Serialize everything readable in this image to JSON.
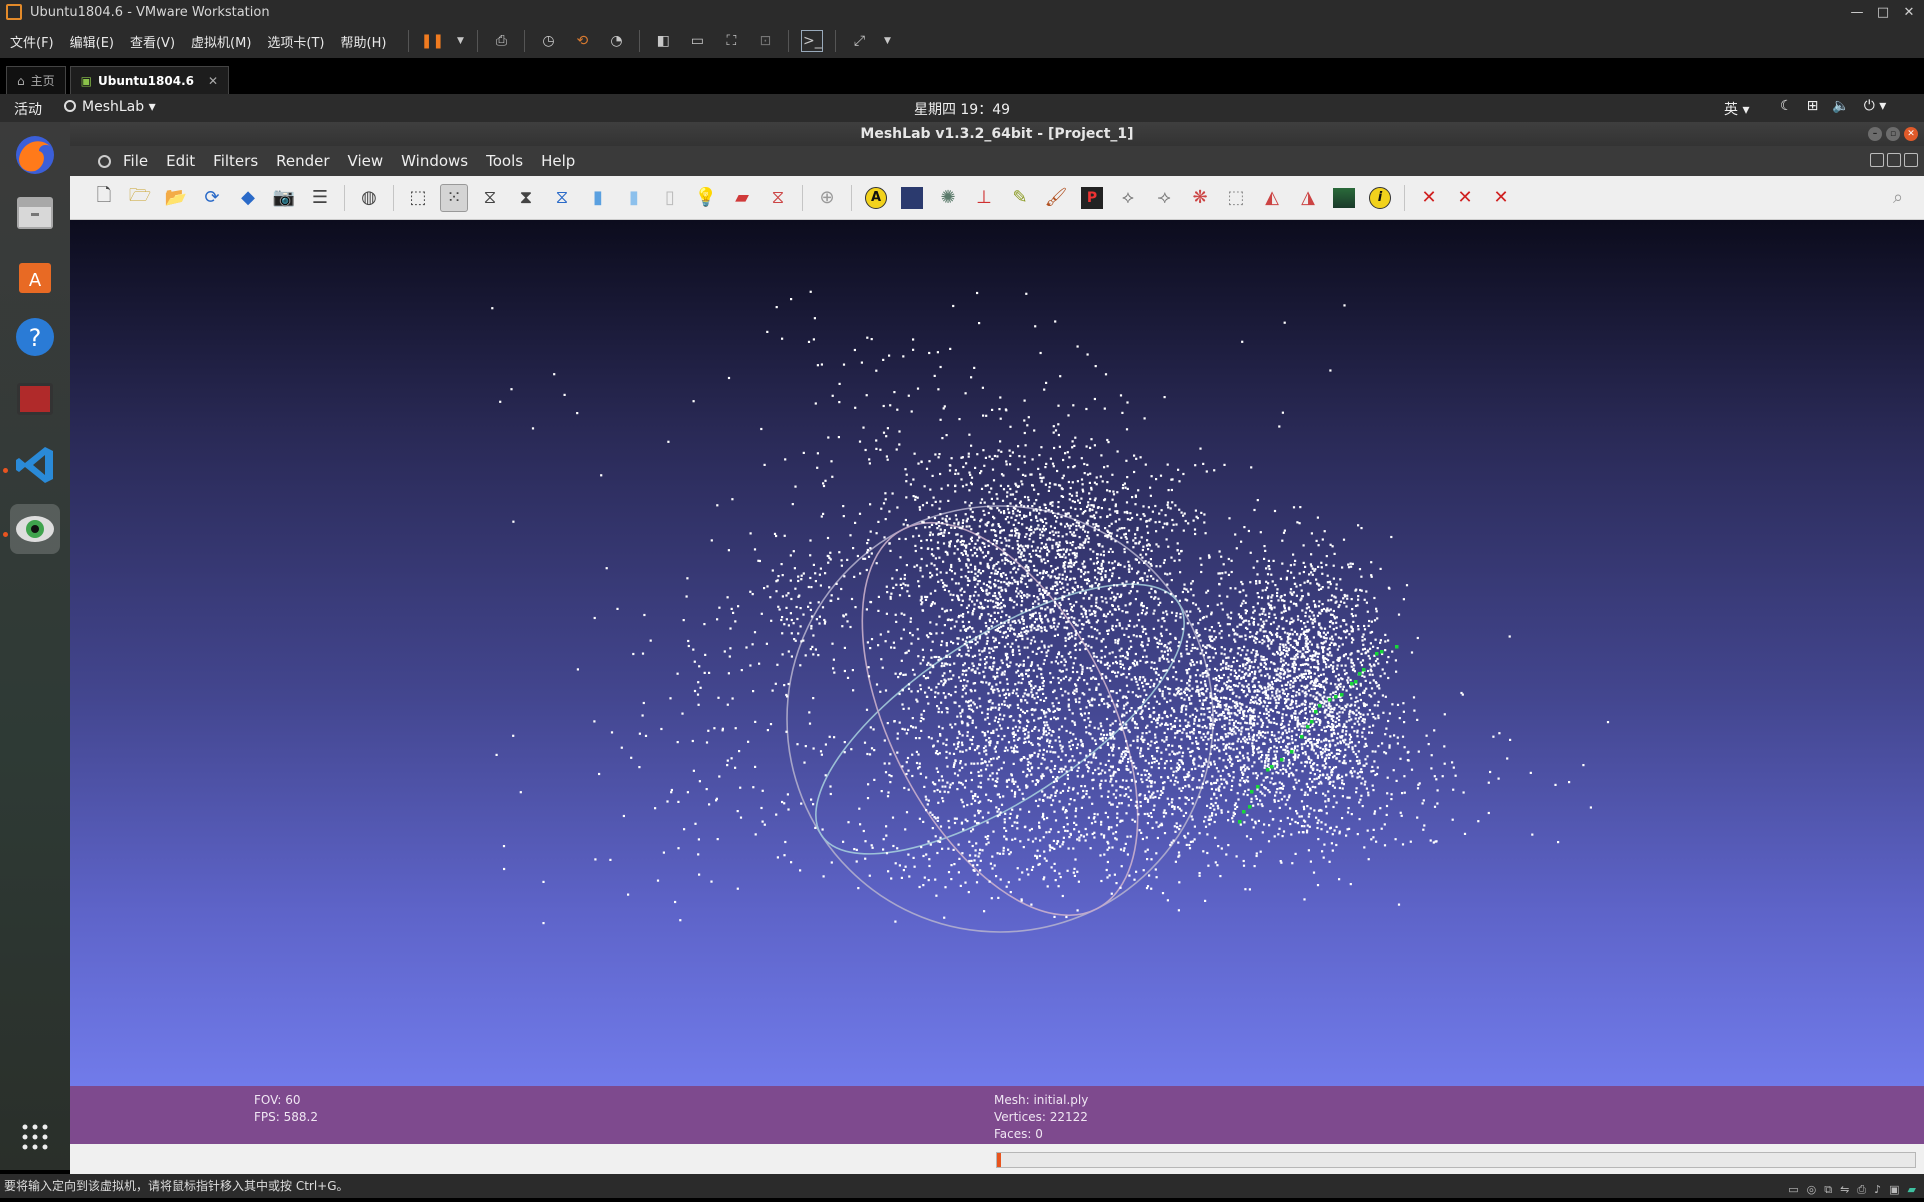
{
  "vmware": {
    "title": "Ubuntu1804.6 - VMware Workstation",
    "menus": [
      "文件(F)",
      "编辑(E)",
      "查看(V)",
      "虚拟机(M)",
      "选项卡(T)",
      "帮助(H)"
    ],
    "tabs": [
      {
        "label": "主页",
        "icon": "home-icon"
      },
      {
        "label": "Ubuntu1804.6",
        "icon": "vm-icon"
      }
    ],
    "status_text": "要将输入定向到该虚拟机，请将鼠标指针移入其中或按 Ctrl+G。"
  },
  "gnome": {
    "activities": "活动",
    "app_menu": "MeshLab ▾",
    "clock": "星期四 19：49",
    "input_method": "英 ▾"
  },
  "meshlab": {
    "window_title": "MeshLab v1.3.2_64bit - [Project_1]",
    "menus": [
      "File",
      "Edit",
      "Filters",
      "Render",
      "View",
      "Windows",
      "Tools",
      "Help"
    ],
    "info": {
      "fov": "FOV: 60",
      "fps": "FPS:   588.2",
      "mesh": "Mesh: initial.ply",
      "vertices": "Vertices: 22122",
      "faces": "Faces: 0"
    },
    "progress_fraction": 0.004
  },
  "colors": {
    "accent": "#e95420",
    "infobar": "#7e4a8e",
    "points": "#ffffff",
    "selected_points": "#18d63a"
  }
}
